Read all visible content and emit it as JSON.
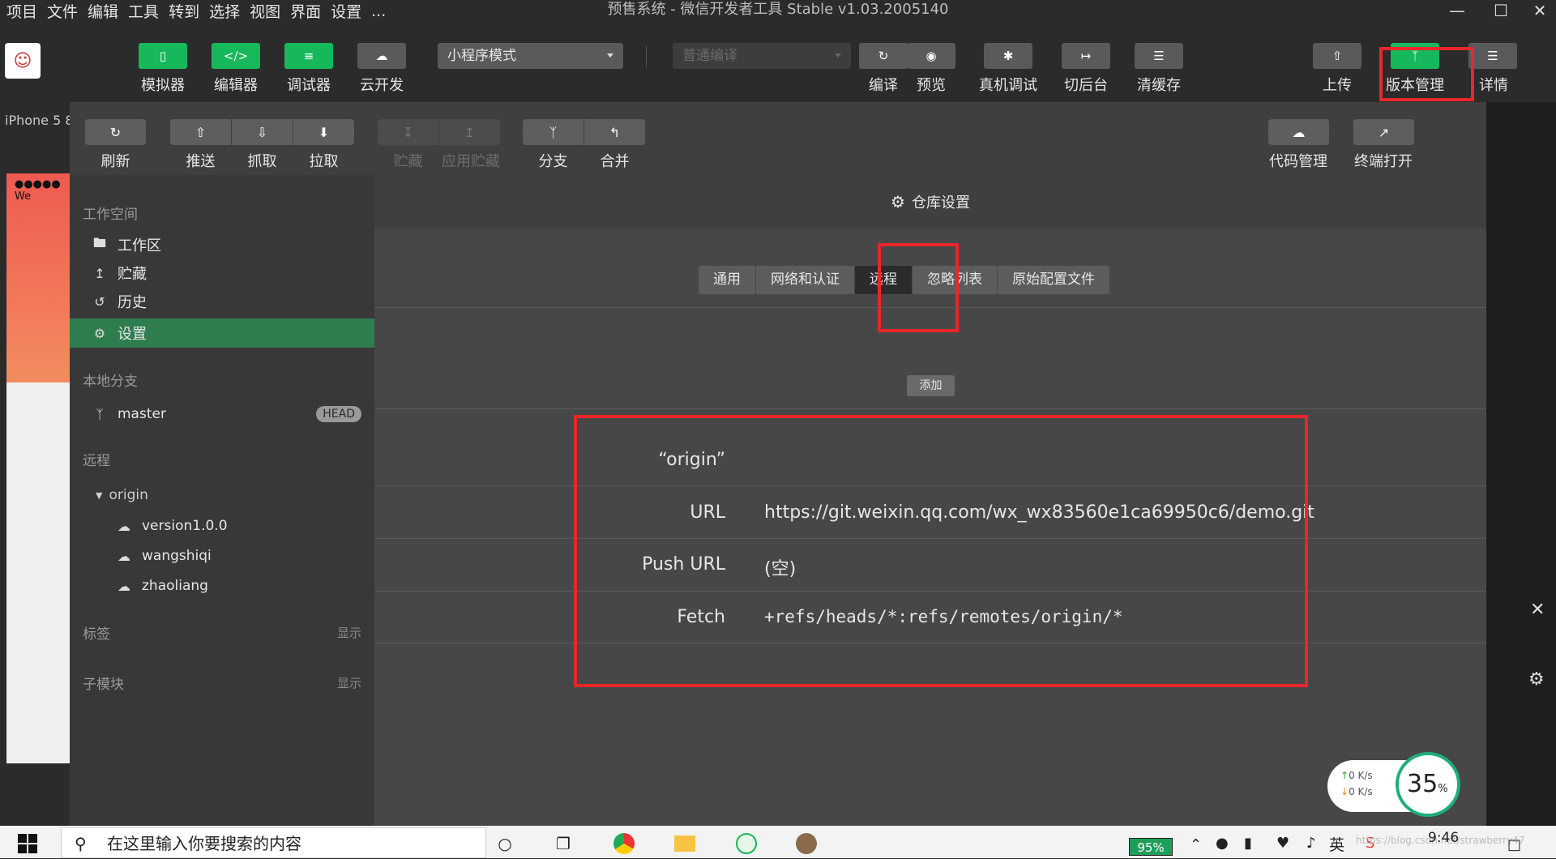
{
  "window": {
    "title": "预售系统 - 微信开发者工具 Stable v1.03.2005140",
    "menu": [
      "项目",
      "文件",
      "编辑",
      "工具",
      "转到",
      "选择",
      "视图",
      "界面",
      "设置",
      "..."
    ]
  },
  "toolbar": {
    "simulator": "模拟器",
    "editor": "编辑器",
    "debugger": "调试器",
    "cloud": "云开发",
    "mode_select": "小程序模式",
    "compile_select": "普通编译",
    "compile": "编译",
    "preview": "预览",
    "real_debug": "真机调试",
    "background": "切后台",
    "clear_cache": "清缓存",
    "upload": "上传",
    "version_mgmt": "版本管理",
    "details": "详情"
  },
  "simulator": {
    "device": "iPhone 5 8",
    "status": "●●●●● We"
  },
  "version_toolbar": {
    "refresh": "刷新",
    "push": "推送",
    "fetch": "抓取",
    "pull": "拉取",
    "stash": "贮藏",
    "apply_stash": "应用贮藏",
    "branch": "分支",
    "merge": "合并",
    "code_mgmt": "代码管理",
    "terminal": "终端打开"
  },
  "sidebar": {
    "workspace_title": "工作空间",
    "items": [
      "工作区",
      "贮藏",
      "历史",
      "设置"
    ],
    "local_branch_title": "本地分支",
    "branch": "master",
    "head_badge": "HEAD",
    "remote_title": "远程",
    "remote_name": "origin",
    "remote_branches": [
      "version1.0.0",
      "wangshiqi",
      "zhaoliang"
    ],
    "tags_title": "标签",
    "tags_show": "显示",
    "submodule_title": "子模块",
    "submodule_show": "显示"
  },
  "content": {
    "header": "仓库设置",
    "tabs": [
      "通用",
      "网络和认证",
      "远程",
      "忽略列表",
      "原始配置文件"
    ],
    "active_tab": "远程",
    "add_button": "添加",
    "remote_name": "“origin”",
    "url_label": "URL",
    "url_value": "https://git.weixin.qq.com/wx_wx83560e1ca69950c6/demo.git",
    "push_url_label": "Push URL",
    "push_url_value": "(空)",
    "fetch_label": "Fetch",
    "fetch_value": "+refs/heads/*:refs/remotes/origin/*"
  },
  "network_widget": {
    "up": "0  K/s",
    "down": "0  K/s",
    "percent": "35",
    "percent_sign": "%"
  },
  "taskbar": {
    "search_placeholder": "在这里输入你要搜索的内容",
    "battery": "95%",
    "ime": "英",
    "time": "9:46",
    "watermark": "https://blog.csdn.net/strawberry47"
  },
  "colors": {
    "accent_green": "#17b85c",
    "selected_green": "#2e7d4f",
    "highlight_red": "#e9272a"
  }
}
